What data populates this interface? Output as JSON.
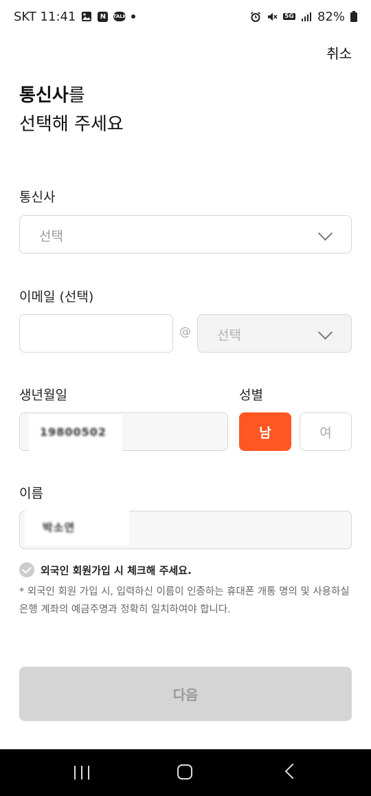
{
  "status_bar": {
    "carrier_time": "SKT 11:41",
    "n_icon": "N",
    "talk_icon": "TALK",
    "network": "5G",
    "battery": "82%"
  },
  "header": {
    "cancel_label": "취소",
    "title_bold": "통신사",
    "title_rest": "를",
    "title_line2": "선택해 주세요"
  },
  "carrier": {
    "label": "통신사",
    "placeholder": "선택"
  },
  "email": {
    "label": "이메일 (선택)",
    "at_sign": "@",
    "domain_placeholder": "선택"
  },
  "birth": {
    "label": "생년월일",
    "value": "19800502"
  },
  "gender": {
    "label": "성별",
    "male": "남",
    "female": "여",
    "selected": "male",
    "active_color": "#ff5722"
  },
  "name": {
    "label": "이름",
    "value": "박소연"
  },
  "foreigner": {
    "label": "외국인 회원가입 시 체크해 주세요.",
    "notice": "* 외국인 회원 가입 시, 입력하신 이름이 인증하는 휴대폰 개통 명의 및 사용하실 은행 계좌의 예금주명과 정확히 일치하여야 합니다."
  },
  "next_button": {
    "label": "다음"
  }
}
